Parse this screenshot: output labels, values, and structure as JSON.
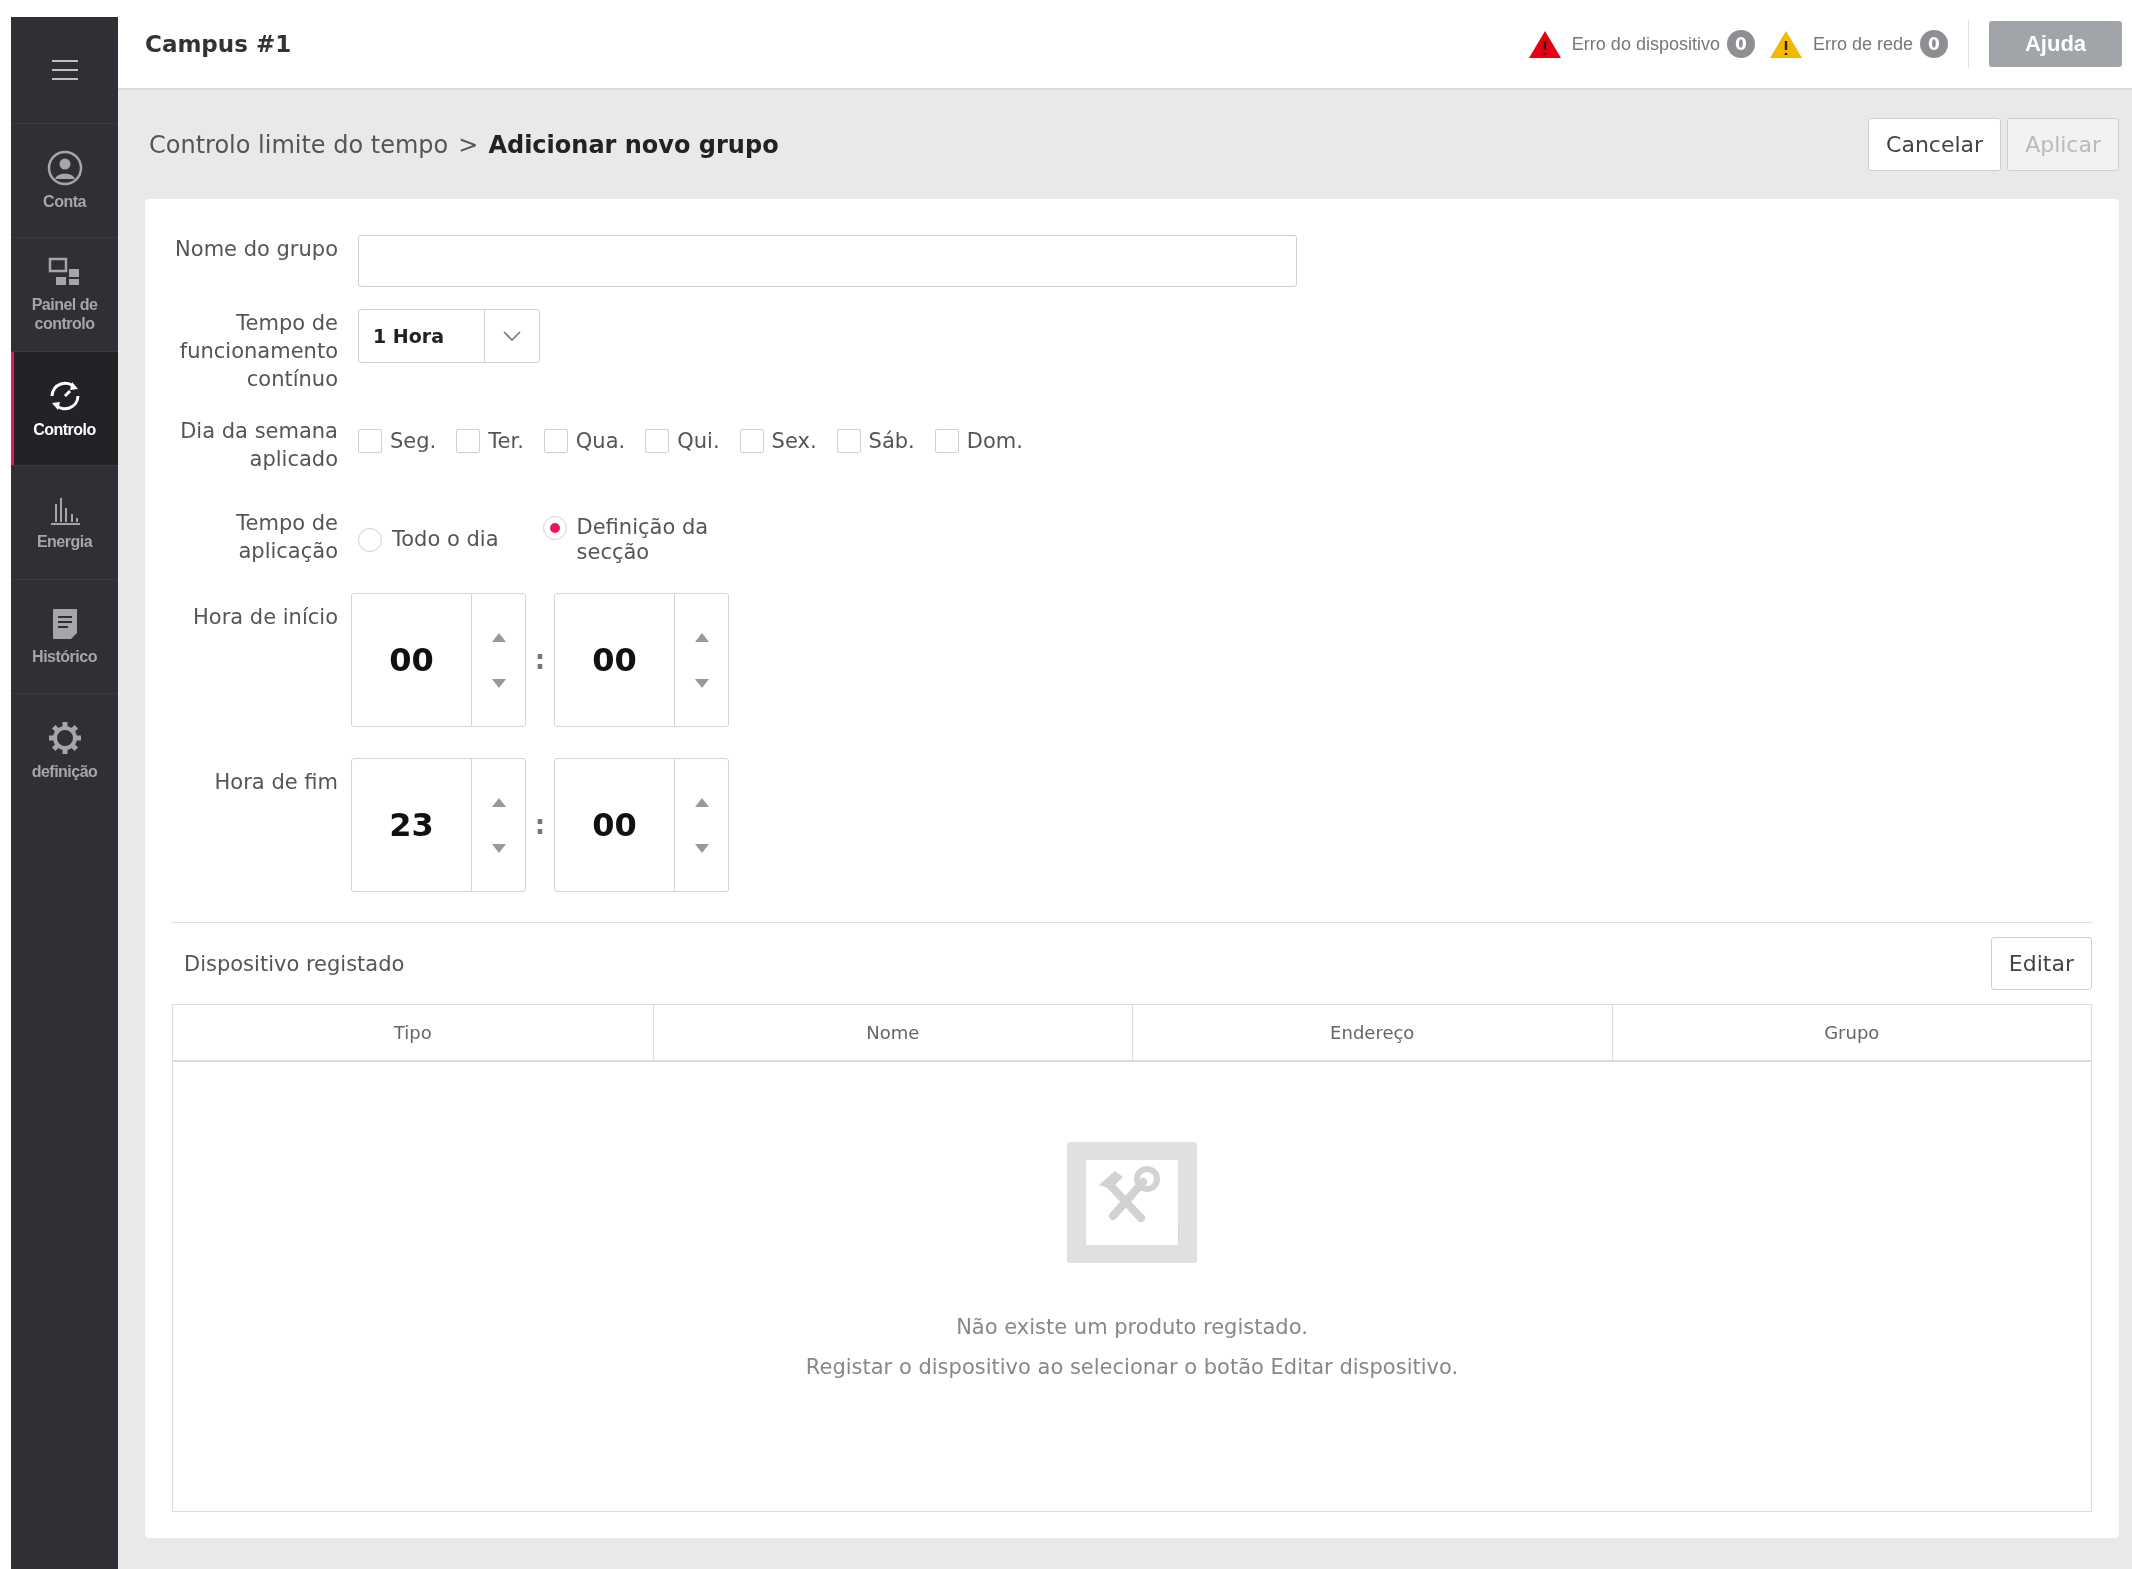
{
  "header": {
    "title": "Campus #1",
    "alerts": [
      {
        "label": "Erro do dispositivo",
        "count": "0",
        "color": "#e60012"
      },
      {
        "label": "Erro de rede",
        "count": "0",
        "color": "#f5b800"
      }
    ],
    "help_button": "Ajuda"
  },
  "sidebar": {
    "items": [
      {
        "kind": "account",
        "label": "Conta",
        "selected": false
      },
      {
        "kind": "dashboard",
        "label": "Painel de controlo",
        "selected": false
      },
      {
        "kind": "control",
        "label": "Controlo",
        "selected": true
      },
      {
        "kind": "energy",
        "label": "Energia",
        "selected": false
      },
      {
        "kind": "history",
        "label": "Histórico",
        "selected": false
      },
      {
        "kind": "settings",
        "label": "definição",
        "selected": false
      }
    ]
  },
  "breadcrumb": {
    "parent": "Controlo limite do tempo",
    "separator": ">",
    "current": "Adicionar novo grupo"
  },
  "actions": [
    {
      "label": "Cancelar",
      "disabled": false
    },
    {
      "label": "Aplicar",
      "disabled": true
    }
  ],
  "form": {
    "group_name": {
      "label": "Nome do grupo"
    },
    "continuous_time": {
      "label": "Tempo de funcionamento contínuo",
      "value": "1 Hora"
    },
    "weekdays": {
      "label": "Dia da semana aplicado",
      "days": [
        {
          "label": "Seg.",
          "checked": false
        },
        {
          "label": "Ter.",
          "checked": false
        },
        {
          "label": "Qua.",
          "checked": false
        },
        {
          "label": "Qui.",
          "checked": false
        },
        {
          "label": "Sex.",
          "checked": false
        },
        {
          "label": "Sáb.",
          "checked": false
        },
        {
          "label": "Dom.",
          "checked": false
        }
      ]
    },
    "application_time": {
      "label": "Tempo de aplicação",
      "options": [
        {
          "label": "Todo o dia",
          "selected": false
        },
        {
          "label": "Definição da secção",
          "selected": true
        }
      ]
    },
    "start_time": {
      "label": "Hora de início",
      "hour": "00",
      "separator": ":",
      "minute": "00"
    },
    "end_time": {
      "label": "Hora de fim",
      "hour": "23",
      "separator": ":",
      "minute": "00"
    }
  },
  "devices": {
    "title": "Dispositivo registado",
    "edit_button": "Editar",
    "columns": [
      "Tipo",
      "Nome",
      "Endereço",
      "Grupo"
    ],
    "empty_message": [
      "Não existe um produto registado.",
      "Registar o dispositivo ao selecionar o botão Editar dispositivo."
    ]
  }
}
